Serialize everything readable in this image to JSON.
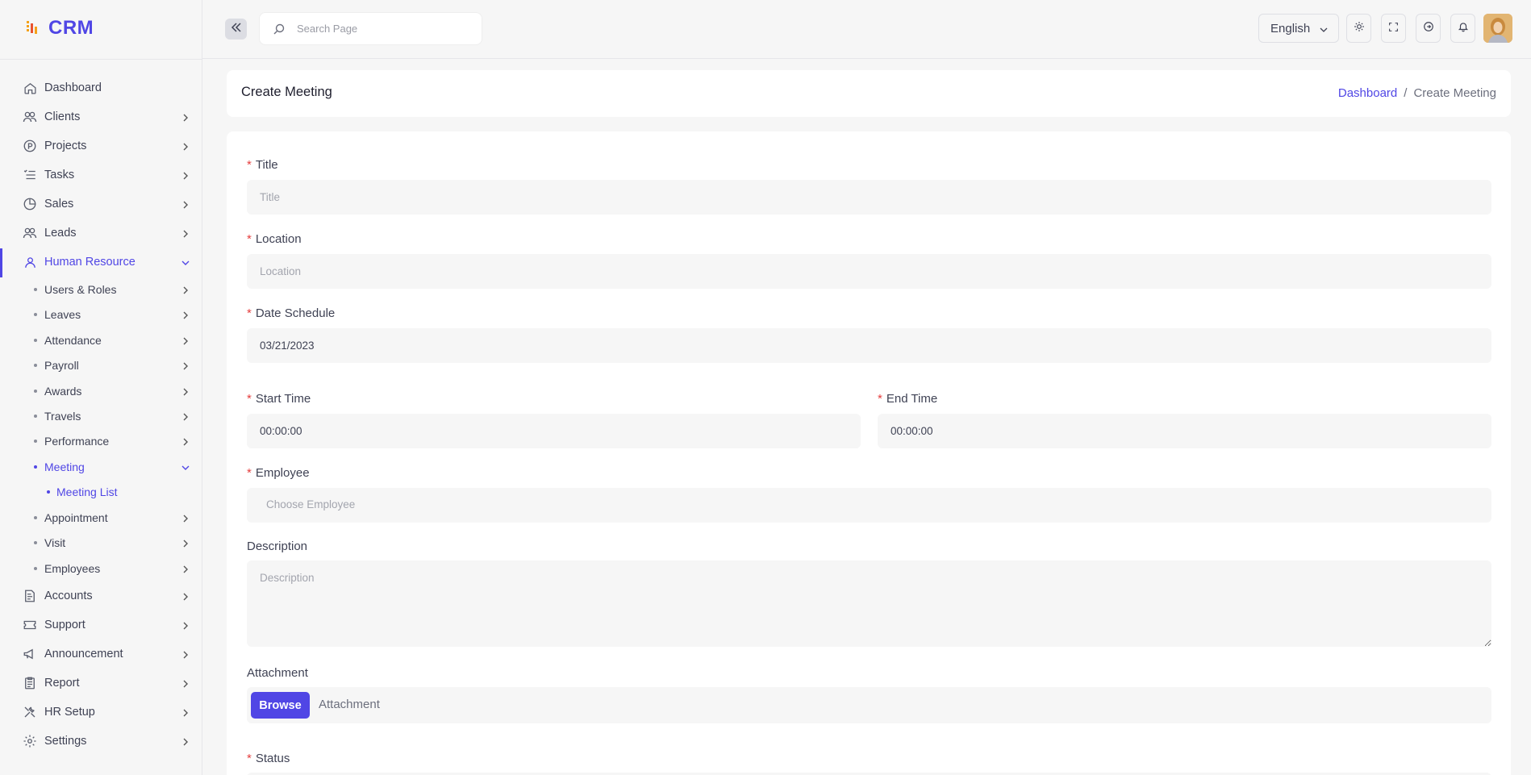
{
  "app": {
    "brand": "CRM"
  },
  "topbar": {
    "search_placeholder": "Search Page",
    "language": "English",
    "icons": [
      "double-chevron-left-icon",
      "search-icon",
      "sun-icon",
      "fullscreen-icon",
      "arrow-circle-icon",
      "bell-icon"
    ]
  },
  "sidebar": {
    "items": [
      {
        "label": "Dashboard",
        "icon": "home-icon"
      },
      {
        "label": "Clients",
        "icon": "users-icon"
      },
      {
        "label": "Projects",
        "icon": "p-circle-icon"
      },
      {
        "label": "Tasks",
        "icon": "list-check-icon"
      },
      {
        "label": "Sales",
        "icon": "pie-chart-icon"
      },
      {
        "label": "Leads",
        "icon": "users-icon"
      },
      {
        "label": "Human Resource",
        "icon": "user-icon",
        "active": true
      },
      {
        "label": "Accounts",
        "icon": "invoice-icon"
      },
      {
        "label": "Support",
        "icon": "ticket-icon"
      },
      {
        "label": "Announcement",
        "icon": "megaphone-icon"
      },
      {
        "label": "Report",
        "icon": "clipboard-icon"
      },
      {
        "label": "HR Setup",
        "icon": "tools-icon"
      },
      {
        "label": "Settings",
        "icon": "gear-icon"
      }
    ],
    "hr_sub": [
      {
        "label": "Users & Roles"
      },
      {
        "label": "Leaves"
      },
      {
        "label": "Attendance"
      },
      {
        "label": "Payroll"
      },
      {
        "label": "Awards"
      },
      {
        "label": "Travels"
      },
      {
        "label": "Performance"
      },
      {
        "label": "Meeting",
        "active": true
      },
      {
        "label": "Appointment"
      },
      {
        "label": "Visit"
      },
      {
        "label": "Employees"
      }
    ],
    "meeting_sub": [
      {
        "label": "Meeting List",
        "active": true
      }
    ]
  },
  "header": {
    "title": "Create Meeting",
    "breadcrumb": {
      "home": "Dashboard",
      "separator": "/",
      "current": "Create Meeting"
    }
  },
  "form": {
    "title": {
      "label": "Title",
      "placeholder": "Title",
      "value": ""
    },
    "location": {
      "label": "Location",
      "placeholder": "Location",
      "value": ""
    },
    "date_schedule": {
      "label": "Date Schedule",
      "value": "03/21/2023"
    },
    "start_time": {
      "label": "Start Time",
      "value": "00:00:00"
    },
    "end_time": {
      "label": "End Time",
      "value": "00:00:00"
    },
    "employee": {
      "label": "Employee",
      "placeholder": "Choose Employee"
    },
    "description": {
      "label": "Description",
      "placeholder": "Description"
    },
    "attachment": {
      "label": "Attachment",
      "button": "Browse",
      "text": "Attachment"
    },
    "status": {
      "label": "Status"
    },
    "required_mark": "*"
  },
  "colors": {
    "accent": "#5046e5",
    "required": "#e53e3e",
    "field_bg": "#f6f6f6"
  }
}
